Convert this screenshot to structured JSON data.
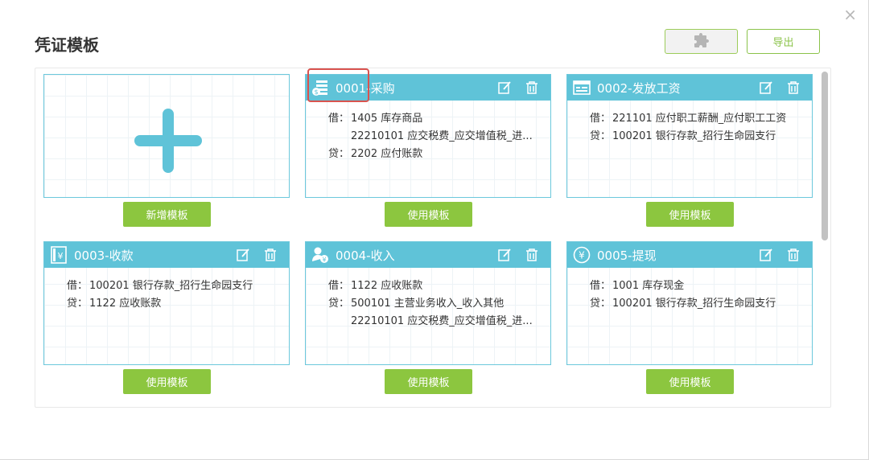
{
  "dialog": {
    "title": "凭证模板",
    "export_label": "导出",
    "close_glyph": "×"
  },
  "add_card": {
    "button_label": "新增模板"
  },
  "templates": [
    {
      "name": "0001-采购",
      "icon": "invoice-icon",
      "lines": [
        {
          "label": "借：",
          "text": "1405 库存商品"
        },
        {
          "label": "",
          "text": "22210101 应交税费_应交增值税_进..."
        },
        {
          "label": "贷：",
          "text": "2202 应付账款"
        }
      ],
      "button_label": "使用模板"
    },
    {
      "name": "0002-发放工资",
      "icon": "payroll-icon",
      "lines": [
        {
          "label": "借：",
          "text": "221101 应付职工薪酬_应付职工工资"
        },
        {
          "label": "贷：",
          "text": "100201 银行存款_招行生命园支行"
        }
      ],
      "button_label": "使用模板"
    },
    {
      "name": "0003-收款",
      "icon": "receipt-icon",
      "lines": [
        {
          "label": "借：",
          "text": "100201 银行存款_招行生命园支行"
        },
        {
          "label": "贷：",
          "text": "1122 应收账款"
        }
      ],
      "button_label": "使用模板"
    },
    {
      "name": "0004-收入",
      "icon": "income-icon",
      "lines": [
        {
          "label": "借：",
          "text": "1122 应收账款"
        },
        {
          "label": "贷：",
          "text": "500101 主营业务收入_收入其他"
        },
        {
          "label": "",
          "text": "22210101 应交税费_应交增值税_进..."
        }
      ],
      "button_label": "使用模板"
    },
    {
      "name": "0005-提现",
      "icon": "yen-icon",
      "lines": [
        {
          "label": "借：",
          "text": "1001 库存现金"
        },
        {
          "label": "贷：",
          "text": "100201 银行存款_招行生命园支行"
        }
      ],
      "button_label": "使用模板"
    }
  ],
  "colors": {
    "accent": "#5fc3d8",
    "button": "#8cc63f",
    "highlight": "#d9534f"
  }
}
